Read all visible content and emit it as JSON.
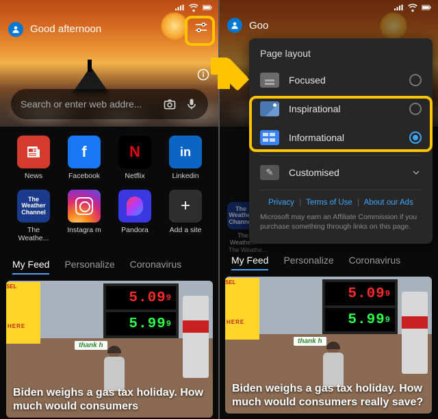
{
  "greeting": "Good afternoon",
  "greeting_trunc": "Goo",
  "search_placeholder": "Search or enter web addre...",
  "apps": [
    {
      "name": "News"
    },
    {
      "name": "Facebook"
    },
    {
      "name": "Netflix"
    },
    {
      "name": "Linkedin"
    },
    {
      "name": "The Weathe..."
    },
    {
      "name": "Instagra m"
    },
    {
      "name": "Pandora"
    },
    {
      "name": "Add a site"
    }
  ],
  "weather_tile_text": "The Weather Channel",
  "tabs": {
    "feed": "My Feed",
    "personalize": "Personalize",
    "corona": "Coronavirus"
  },
  "gas": {
    "p1": "5.09",
    "p1s": "9",
    "p2": "5.99",
    "p2s": "9",
    "banner": "SEL",
    "thank": "thank h"
  },
  "headline_left": "Biden weighs a gas tax holiday. How much would consumers",
  "headline_right": "Biden weighs a gas tax holiday. How much would consumers really save?",
  "popover": {
    "title": "Page layout",
    "focused": "Focused",
    "inspirational": "Inspirational",
    "informational": "Informational",
    "customised": "Customised",
    "privacy": "Privacy",
    "terms": "Terms of Use",
    "ads": "About our Ads",
    "footer": "Microsoft may earn an Affiliate Commission if you purchase something through links on this page."
  },
  "peek_apps": [
    {
      "name": "The Weathe..."
    }
  ],
  "peek_line2": "The Weathe...",
  "status_text": ""
}
